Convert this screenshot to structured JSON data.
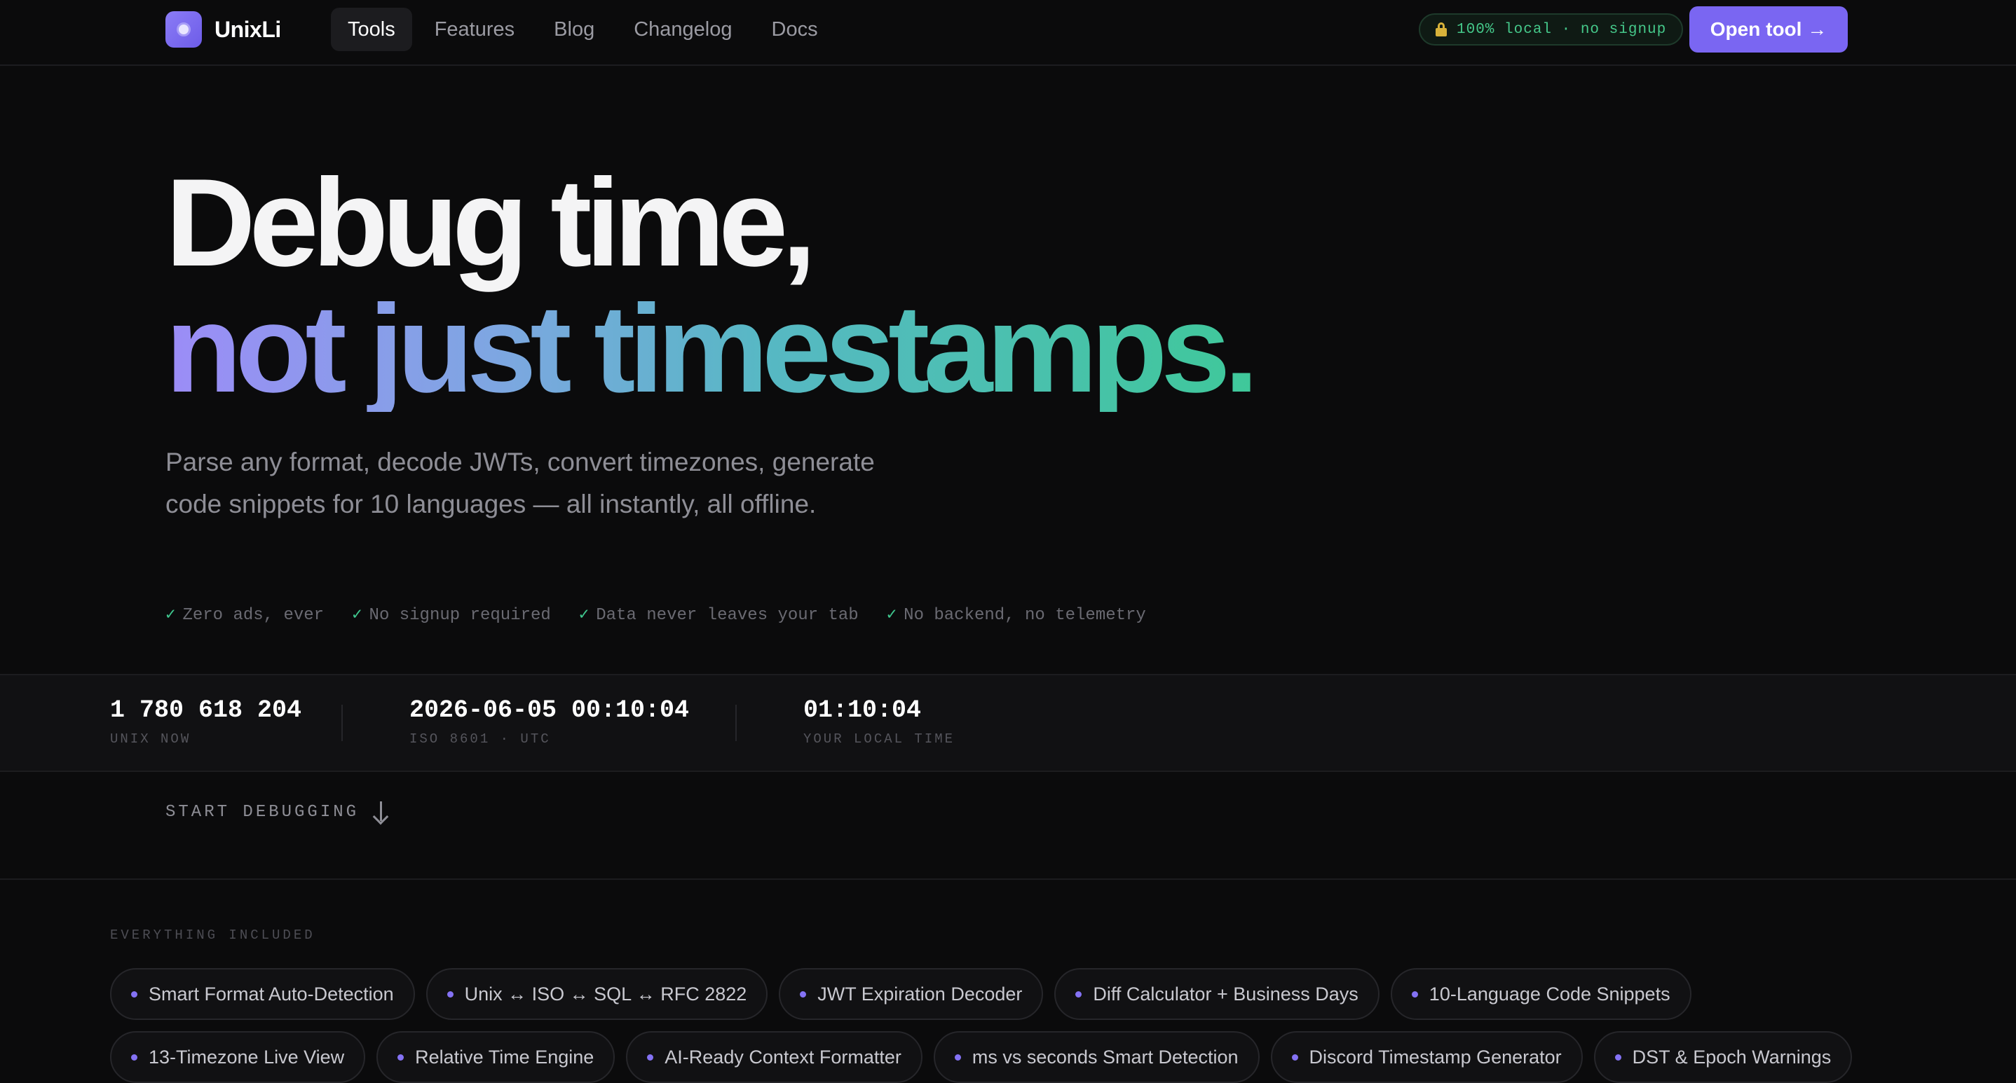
{
  "header": {
    "brand_name": "UnixLi",
    "nav": [
      {
        "label": "Tools",
        "active": true
      },
      {
        "label": "Features",
        "active": false
      },
      {
        "label": "Blog",
        "active": false
      },
      {
        "label": "Changelog",
        "active": false
      },
      {
        "label": "Docs",
        "active": false
      }
    ],
    "badge_text": "100% local · no signup",
    "open_button_label": "Open tool →",
    "accent_color": "#7a66f2"
  },
  "hero": {
    "line1": "Debug time,",
    "line2": "not just timestamps.",
    "subtitle": "Parse any format, decode JWTs, convert timezones, generate code snippets for 10 languages — all instantly, all offline.",
    "checks": [
      "Zero ads, ever",
      "No signup required",
      "Data never leaves your tab",
      "No backend, no telemetry"
    ],
    "check_mark": "✓"
  },
  "stats": [
    {
      "value": "1 780 618 204",
      "label": "UNIX NOW"
    },
    {
      "value": "2026-06-05 00:10:04",
      "label": "ISO 8601 · UTC"
    },
    {
      "value": "01:10:04",
      "label": "YOUR LOCAL TIME"
    }
  ],
  "cta": {
    "label": "START DEBUGGING",
    "icon": "arrow-down-icon"
  },
  "included": {
    "label": "EVERYTHING INCLUDED",
    "chips": [
      "Smart Format Auto-Detection",
      "Unix ↔ ISO ↔ SQL ↔ RFC 2822",
      "JWT Expiration Decoder",
      "Diff Calculator + Business Days",
      "10-Language Code Snippets",
      "13-Timezone Live View",
      "Relative Time Engine",
      "AI-Ready Context Formatter",
      "ms vs seconds Smart Detection",
      "Discord Timestamp Generator",
      "DST & Epoch Warnings"
    ]
  }
}
